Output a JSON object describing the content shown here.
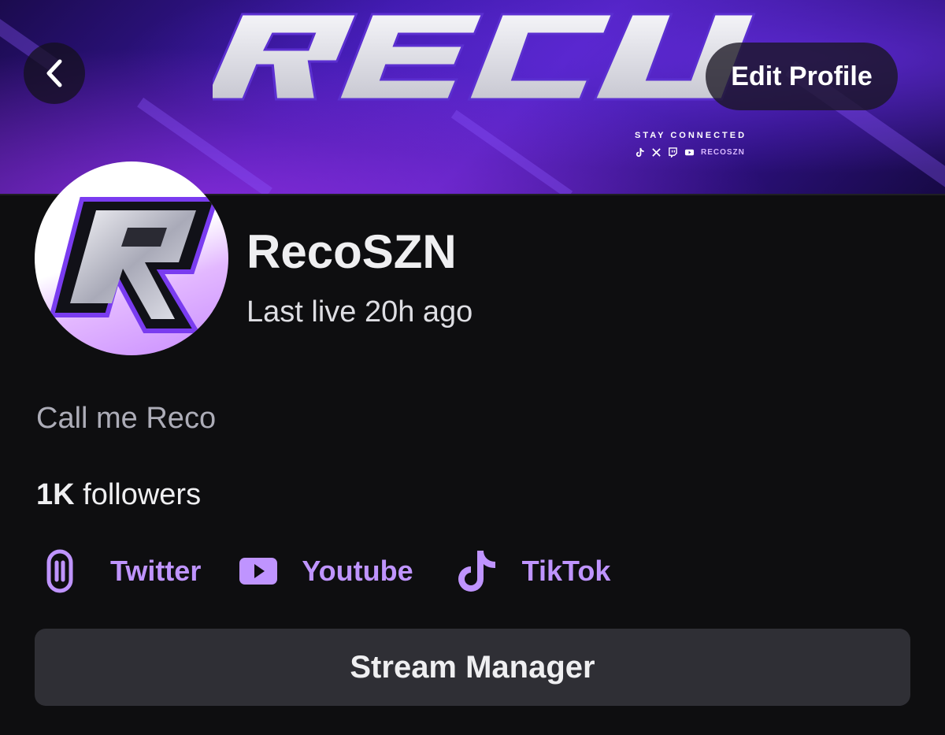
{
  "banner": {
    "logo_text": "RECO",
    "tagline": "STAY CONNECTED",
    "handle": "RECOSZN",
    "social_icons": [
      "tiktok-icon",
      "x-icon",
      "twitch-icon",
      "youtube-icon"
    ]
  },
  "header": {
    "back_icon": "chevron-left-icon",
    "edit_label": "Edit Profile"
  },
  "profile": {
    "username": "RecoSZN",
    "last_live": "Last live 20h ago",
    "bio": "Call me Reco",
    "followers_count": "1K",
    "followers_label": "followers"
  },
  "social_links": [
    {
      "label": "Twitter",
      "icon": "link-icon"
    },
    {
      "label": "Youtube",
      "icon": "youtube-icon"
    },
    {
      "label": "TikTok",
      "icon": "tiktok-icon"
    }
  ],
  "actions": {
    "stream_manager_label": "Stream Manager"
  },
  "colors": {
    "background": "#0e0e10",
    "accent": "#bf94ff",
    "button_bg": "#2f2f35"
  }
}
